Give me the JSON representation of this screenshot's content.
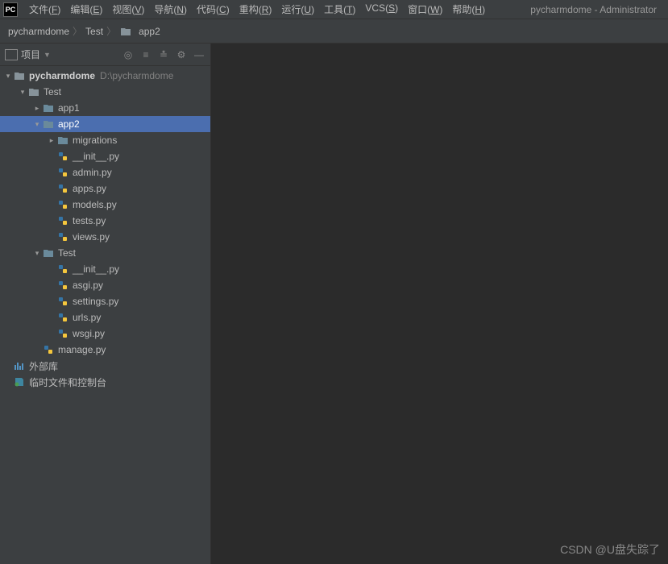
{
  "title_right": "pycharmdome - Administrator",
  "menu": [
    "文件(F)",
    "编辑(E)",
    "视图(V)",
    "导航(N)",
    "代码(C)",
    "重构(R)",
    "运行(U)",
    "工具(T)",
    "VCS(S)",
    "窗口(W)",
    "帮助(H)"
  ],
  "breadcrumb": {
    "root": "pycharmdome",
    "mid": "Test",
    "leaf": "app2"
  },
  "sidebar": {
    "label": "项目"
  },
  "tree": {
    "root": {
      "name": "pycharmdome",
      "path": "D:\\pycharmdome"
    },
    "test_dir": "Test",
    "app1": "app1",
    "app2": "app2",
    "migrations": "migrations",
    "files_app2": [
      "__init__.py",
      "admin.py",
      "apps.py",
      "models.py",
      "tests.py",
      "views.py"
    ],
    "test_inner": "Test",
    "files_test": [
      "__init__.py",
      "asgi.py",
      "settings.py",
      "urls.py",
      "wsgi.py"
    ],
    "manage": "manage.py",
    "ext_lib": "外部库",
    "scratch": "临时文件和控制台"
  },
  "watermark": "CSDN @U盘失踪了"
}
